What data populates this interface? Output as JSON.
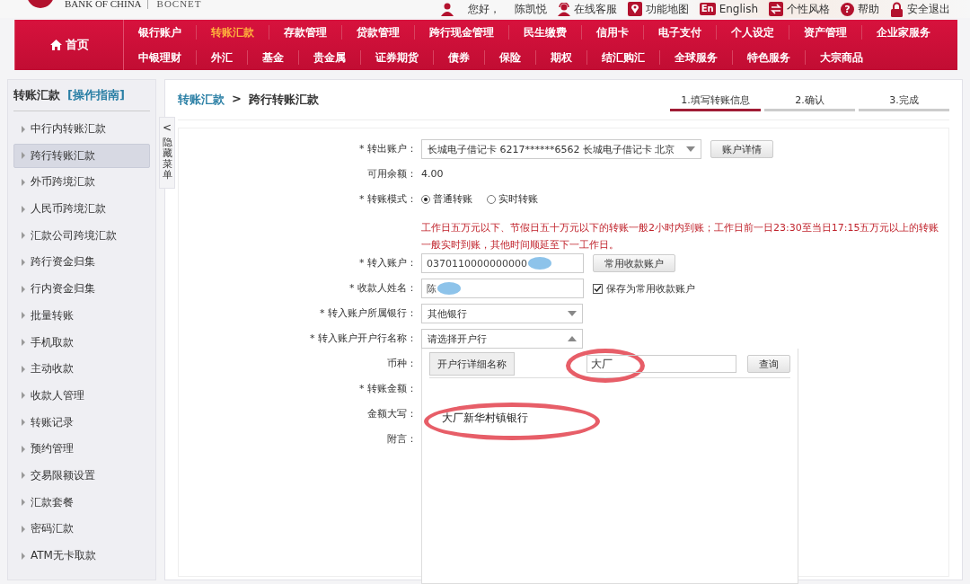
{
  "header": {
    "logo": [
      "BANK OF CHINA",
      "BOCNET"
    ],
    "greeting": "您好，",
    "user": "陈凯悦",
    "links": [
      {
        "kind": "person",
        "label": "在线客服"
      },
      {
        "kind": "pin",
        "label": "功能地图"
      },
      {
        "kind": "badge",
        "badge": "En",
        "label": "English"
      },
      {
        "kind": "swap",
        "label": "个性风格"
      },
      {
        "kind": "round",
        "badge": "?",
        "label": "帮助"
      },
      {
        "kind": "lock",
        "label": "安全退出"
      }
    ]
  },
  "nav": {
    "home": "首页",
    "menu_lines": [
      {
        "items": [
          {
            "label": "银行账户",
            "selected": false
          },
          {
            "label": "转账汇款",
            "selected": true
          },
          {
            "label": "存款管理",
            "selected": false
          },
          {
            "label": "贷款管理",
            "selected": false
          },
          {
            "label": "跨行现金管理",
            "selected": false
          },
          {
            "label": "民生缴费",
            "selected": false
          },
          {
            "label": "信用卡",
            "selected": false
          },
          {
            "label": "电子支付",
            "selected": false
          },
          {
            "label": "个人设定",
            "selected": false
          },
          {
            "label": "资产管理",
            "selected": false
          },
          {
            "label": "企业家服务",
            "selected": false
          }
        ]
      },
      {
        "items": [
          {
            "label": "中银理财",
            "selected": false
          },
          {
            "label": "外汇",
            "selected": false
          },
          {
            "label": "基金",
            "selected": false
          },
          {
            "label": "贵金属",
            "selected": false
          },
          {
            "label": "证券期货",
            "selected": false
          },
          {
            "label": "债券",
            "selected": false
          },
          {
            "label": "保险",
            "selected": false
          },
          {
            "label": "期权",
            "selected": false
          },
          {
            "label": "结汇购汇",
            "selected": false
          },
          {
            "label": "全球服务",
            "selected": false
          },
          {
            "label": "特色服务",
            "selected": false
          },
          {
            "label": "大宗商品",
            "selected": false
          }
        ]
      }
    ]
  },
  "sidebar": {
    "title": "转账汇款",
    "guide": "[操作指南]",
    "collapse": {
      "arrow": "<",
      "label": "隐藏菜单"
    },
    "items": [
      {
        "label": "中行内转账汇款",
        "selected": false
      },
      {
        "label": "跨行转账汇款",
        "selected": true
      },
      {
        "label": "外币跨境汇款",
        "selected": false
      },
      {
        "label": "人民币跨境汇款",
        "selected": false
      },
      {
        "label": "汇款公司跨境汇款",
        "selected": false
      },
      {
        "label": "跨行资金归集",
        "selected": false
      },
      {
        "label": "行内资金归集",
        "selected": false
      },
      {
        "label": "批量转账",
        "selected": false
      },
      {
        "label": "手机取款",
        "selected": false
      },
      {
        "label": "主动收款",
        "selected": false
      },
      {
        "label": "收款人管理",
        "selected": false
      },
      {
        "label": "转账记录",
        "selected": false
      },
      {
        "label": "预约管理",
        "selected": false
      },
      {
        "label": "交易限额设置",
        "selected": false
      },
      {
        "label": "汇款套餐",
        "selected": false
      },
      {
        "label": "密码汇款",
        "selected": false
      },
      {
        "label": "ATM无卡取款",
        "selected": false
      }
    ]
  },
  "breadcrumb": {
    "parent": "转账汇款",
    "separator": ">",
    "current": "跨行转账汇款"
  },
  "steps": [
    {
      "label": "1.填写转账信息",
      "selected": true
    },
    {
      "label": "2.确认",
      "selected": false
    },
    {
      "label": "3.完成",
      "selected": false
    }
  ],
  "form": [
    {
      "kind": "select",
      "label": "* 转出账户：",
      "value": "长城电子借记卡 6217******6562 长城电子借记卡  北京",
      "button": "账户详情"
    },
    {
      "kind": "text",
      "label": "可用余额：",
      "value": "4.00"
    },
    {
      "kind": "radio",
      "label": "* 转账模式：",
      "options": [
        {
          "label": "普通转账",
          "selected": true
        },
        {
          "label": "实时转账",
          "selected": false
        }
      ],
      "note": "工作日五万元以下、节假日五十万元以下的转账一般2小时内到账；工作日前一日23:30至当日17:15五万元以上的转账一般实时到账，其他时间顺延至下一工作日。"
    },
    {
      "kind": "input",
      "label": "* 转入账户：",
      "value": "0370110000000000",
      "redacted": true,
      "button": "常用收款账户"
    },
    {
      "kind": "input",
      "label": "* 收款人姓名：",
      "value": "陈",
      "redacted": true,
      "checkbox": {
        "label": "保存为常用收款账户",
        "checked": true
      }
    },
    {
      "kind": "select",
      "label": "* 转入账户所属银行：",
      "value": "其他银行",
      "expanded": false
    },
    {
      "kind": "select",
      "label": "* 转入账户开户行名称：",
      "value": "请选择开户行",
      "expanded": true
    },
    {
      "kind": "label",
      "label": "币种："
    },
    {
      "kind": "label",
      "label": "* 转账金额："
    },
    {
      "kind": "label",
      "label": "金额大写："
    },
    {
      "kind": "label",
      "label": "附言："
    }
  ],
  "bank_popup": {
    "tab": "开户行详细名称",
    "search": {
      "value": "大厂",
      "circled": true
    },
    "button": "查询",
    "results": [
      {
        "label": "大厂新华村镇银行",
        "circled": true
      }
    ]
  }
}
